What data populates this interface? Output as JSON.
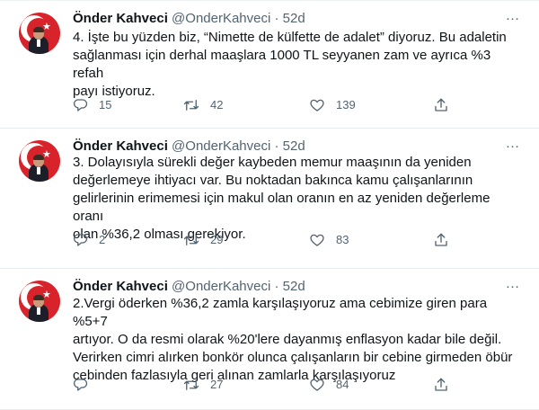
{
  "tweets": [
    {
      "name": "Önder Kahveci",
      "handle": "@OnderKahveci",
      "dot": "·",
      "time": "52d",
      "lines": [
        "4. İşte bu yüzden biz, “Nimette de külfette de adalet” diyoruz.  Bu adaletin",
        "sağlanması için derhal maaşlara 1000 TL seyyanen zam ve ayrıca %3 refah",
        "payı istiyoruz."
      ],
      "replies": "15",
      "retweets": "42",
      "likes": "139"
    },
    {
      "name": "Önder Kahveci",
      "handle": "@OnderKahveci",
      "dot": "·",
      "time": "52d",
      "lines": [
        "3. Dolayısıyla sürekli değer kaybeden memur maaşının da yeniden",
        "değerlemeye ihtiyacı var. Bu noktadan bakınca kamu çalışanlarının",
        "gelirlerinin erimemesi için makul olan oranın en az yeniden değerleme oranı",
        "olan %36,2 olması gerekiyor."
      ],
      "replies": "2",
      "retweets": "29",
      "likes": "83"
    },
    {
      "name": "Önder Kahveci",
      "handle": "@OnderKahveci",
      "dot": "·",
      "time": "52d",
      "lines": [
        "2.Vergi öderken %36,2 zamla karşılaşıyoruz ama cebimize giren para %5+7",
        "artıyor. O da resmi olarak %20'lere dayanmış enflasyon kadar bile değil.",
        "Verirken cimri alırken bonkör olunca çalışanların bir cebine girmeden öbür",
        "cebinden fazlasıyla geri alınan zamlarla karşılaşıyoruz"
      ],
      "replies": "",
      "retweets": "27",
      "likes": "84"
    }
  ],
  "more_icon": "…",
  "icons": {
    "reply": "reply-icon",
    "retweet": "retweet-icon",
    "like": "heart-icon",
    "share": "share-icon",
    "more": "more-icon"
  },
  "colors": {
    "text": "#0f1419",
    "secondary": "#536471",
    "divider": "#e6ecf0",
    "avatar_bg": "#d8232a"
  }
}
